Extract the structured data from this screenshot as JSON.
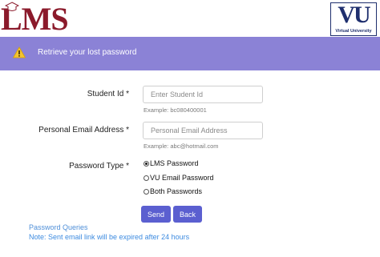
{
  "header": {
    "lms_logo_text": "LMS",
    "vu_logo_text": "VU",
    "vu_logo_caption": "Virtual University"
  },
  "banner": {
    "icon": "warning-icon",
    "message": "Retrieve your lost password",
    "background_color": "#8b82d6"
  },
  "form": {
    "student_id": {
      "label": "Student Id *",
      "placeholder": "Enter Student Id",
      "value": "",
      "hint": "Example: bc080400001"
    },
    "email": {
      "label": "Personal Email Address *",
      "placeholder": "Personal Email Address",
      "value": "",
      "hint": "Example: abc@hotmail.com"
    },
    "password_type": {
      "label": "Password Type *",
      "options": [
        "LMS Password",
        "VU Email Password",
        "Both Passwords"
      ],
      "selected": "LMS Password"
    },
    "send_label": "Send",
    "back_label": "Back"
  },
  "footer": {
    "queries_link": "Password Queries",
    "note": "Note: Sent email link will be expired after 24 hours"
  },
  "colors": {
    "button": "#5b5fd0",
    "link": "#4f8fd8",
    "lms_brand": "#8b1a2b",
    "vu_brand": "#1f2f6e"
  }
}
